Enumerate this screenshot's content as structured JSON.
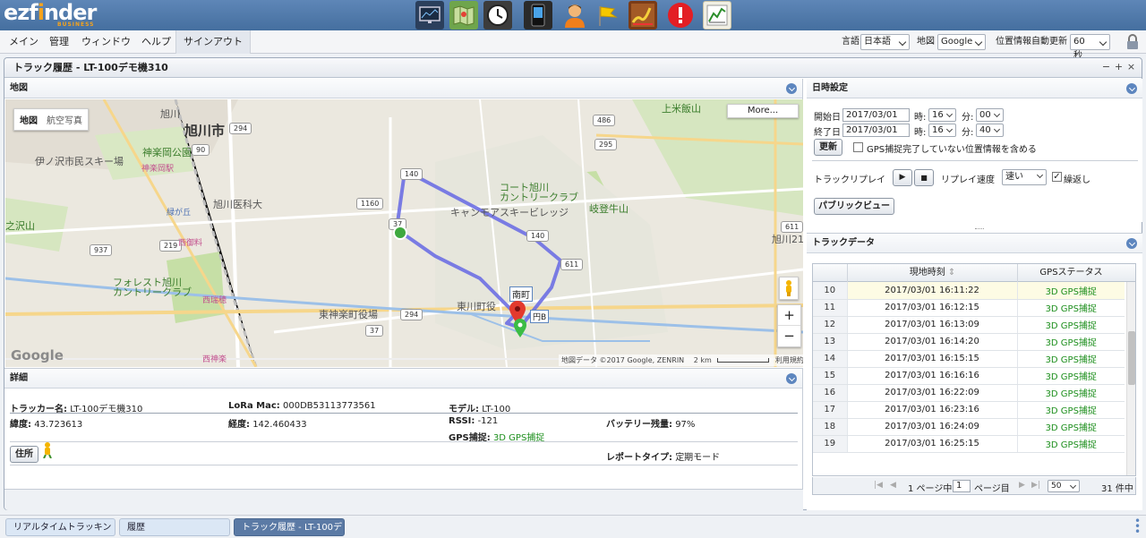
{
  "app": {
    "logo_main": "ezfinder",
    "logo_sub": "BUSINESS"
  },
  "toolbar_icons": [
    "monitor-icon",
    "map-icon",
    "clock-icon",
    "phone-icon",
    "user-icon",
    "flag-icon",
    "track-route-icon",
    "alert-icon",
    "report-chart-icon"
  ],
  "menu": {
    "items": [
      "メイン",
      "管理",
      "ウィンドウ",
      "ヘルプ",
      "サインアウト"
    ],
    "language_label": "言語",
    "language_value": "日本語",
    "map_label": "地図",
    "map_value": "Google",
    "refresh_label": "位置情報自動更新",
    "refresh_value": "60 秒"
  },
  "window": {
    "title": "トラック履歴 - LT-100デモ機310",
    "min": "−",
    "max": "+",
    "close": "×"
  },
  "map_panel": {
    "title": "地図",
    "type_map": "地図",
    "type_satellite": "航空写真",
    "more": "More...",
    "zoom_in": "+",
    "zoom_out": "−",
    "attribution": "地図データ ©2017 Google, ZENRIN",
    "scale": "2 km",
    "terms": "利用規約",
    "google": "Google",
    "labels": {
      "asahikawa": "旭川市",
      "kagura_oka": "神楽岡公園",
      "ino_sawa": "伊ノ沢市民スキー場",
      "kagura_station": "神楽岡駅",
      "asahikawa_medical": "旭川医科大",
      "midorigaoka": "緑が丘",
      "nishi_goryo": "西御料",
      "forest": "フォレスト旭川\nカントリークラブ",
      "nishi_mizuho": "西瑞穂",
      "higashikagura": "東神楽町役場",
      "nishi_kagura": "西神楽",
      "court": "コート旭川\nカントリークラブ",
      "camp": "キャンモアスキービレッジ",
      "gifu": "岐登牛山",
      "kamiyone": "上米飯山",
      "asahikawa21": "旭川21世",
      "higashikawa": "東川町役",
      "nanmachi": "南町",
      "enba": "円B",
      "zawasan": "之沢山",
      "asahikawa_station": "旭川"
    }
  },
  "details": {
    "title": "詳細",
    "tracker_label": "トラッカー名:",
    "tracker_value": "LT-100デモ機310",
    "lora_label": "LoRa Mac:",
    "lora_value": "000DB53113773561",
    "model_label": "モデル:",
    "model_value": "LT-100",
    "lat_label": "緯度:",
    "lat_value": "43.723613",
    "lng_label": "経度:",
    "lng_value": "142.460433",
    "rssi_label": "RSSI:",
    "rssi_value": "-121",
    "battery_label": "バッテリー残量:",
    "battery_value": "97%",
    "gps_label": "GPS捕捉:",
    "gps_value": "3D GPS捕捉",
    "report_label": "レポートタイプ:",
    "report_value": "定期モード",
    "address_button": "住所"
  },
  "datetime": {
    "title": "日時設定",
    "start_label": "開始日",
    "start_date": "2017/03/01",
    "hour_label": "時:",
    "start_hour": "16",
    "min_label": "分:",
    "start_min": "00",
    "end_label": "終了日",
    "end_date": "2017/03/01",
    "end_hour": "16",
    "end_min": "40",
    "refresh_button": "更新",
    "include_incomplete": "GPS捕捉完了していない位置情報を含める",
    "replay_label": "トラックリプレイ",
    "speed_label": "リプレイ速度",
    "speed_value": "速い",
    "repeat_label": "繰返し",
    "public_view": "パブリックビュー"
  },
  "trackdata": {
    "title": "トラックデータ",
    "col_time": "現地時刻",
    "col_gps": "GPSステータス",
    "rows": [
      {
        "n": "10",
        "time": "2017/03/01 16:11:22",
        "gps": "3D GPS捕捉"
      },
      {
        "n": "11",
        "time": "2017/03/01 16:12:15",
        "gps": "3D GPS捕捉"
      },
      {
        "n": "12",
        "time": "2017/03/01 16:13:09",
        "gps": "3D GPS捕捉"
      },
      {
        "n": "13",
        "time": "2017/03/01 16:14:20",
        "gps": "3D GPS捕捉"
      },
      {
        "n": "14",
        "time": "2017/03/01 16:15:15",
        "gps": "3D GPS捕捉"
      },
      {
        "n": "15",
        "time": "2017/03/01 16:16:16",
        "gps": "3D GPS捕捉"
      },
      {
        "n": "16",
        "time": "2017/03/01 16:22:09",
        "gps": "3D GPS捕捉"
      },
      {
        "n": "17",
        "time": "2017/03/01 16:23:16",
        "gps": "3D GPS捕捉"
      },
      {
        "n": "18",
        "time": "2017/03/01 16:24:09",
        "gps": "3D GPS捕捉"
      },
      {
        "n": "19",
        "time": "2017/03/01 16:25:15",
        "gps": "3D GPS捕捉"
      }
    ],
    "pager_page": "1",
    "pager_prefix": "1 ページ中",
    "pager_suffix": "ページ目",
    "page_size": "50",
    "total": "31 件中"
  },
  "tabs": [
    "リアルタイムトラッキン",
    "履歴",
    "トラック履歴 - LT-100デ"
  ],
  "colors": {
    "accent": "#5d86bf",
    "route": "#6d6fe3",
    "gps_green": "#1d8f1d"
  }
}
